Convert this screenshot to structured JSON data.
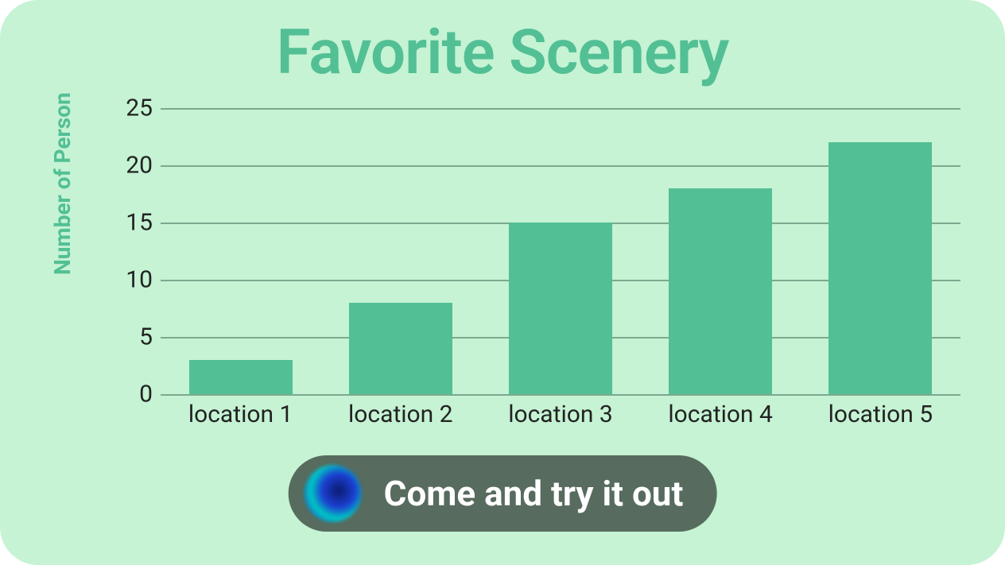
{
  "title": "Favorite Scenery",
  "chart_data": {
    "type": "bar",
    "categories": [
      "location 1",
      "location 2",
      "location 3",
      "location 4",
      "location 5"
    ],
    "values": [
      3,
      8,
      15,
      18,
      22
    ],
    "title": "Favorite Scenery",
    "xlabel": "",
    "ylabel": "Number of Person",
    "ylim": [
      0,
      25
    ],
    "yticks": [
      0,
      5,
      10,
      15,
      20,
      25
    ]
  },
  "cta": {
    "label": "Come and try it out"
  }
}
